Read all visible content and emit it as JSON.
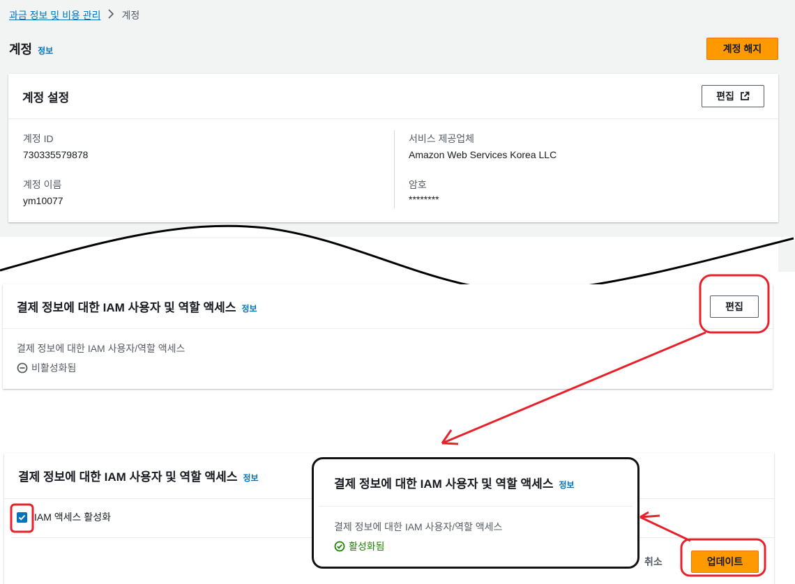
{
  "breadcrumb": {
    "parent": "과금 정보 및 비용 관리",
    "current": "계정"
  },
  "page": {
    "title": "계정",
    "info": "정보",
    "close_account": "계정 해지"
  },
  "account_settings": {
    "title": "계정 설정",
    "edit": "편집",
    "account_id_label": "계정 ID",
    "account_id": "730335579878",
    "account_name_label": "계정 이름",
    "account_name": "ym10077",
    "provider_label": "서비스 제공업체",
    "provider": "Amazon Web Services Korea LLC",
    "password_label": "암호",
    "password": "********"
  },
  "iam_access_view": {
    "title": "결제 정보에 대한 IAM 사용자 및 역할 액세스",
    "info": "정보",
    "edit": "편집",
    "field_label": "결제 정보에 대한 IAM 사용자/역할 액세스",
    "status": "비활성화됨"
  },
  "iam_access_edit": {
    "title": "결제 정보에 대한 IAM 사용자 및 역할 액세스",
    "info": "정보",
    "checkbox_label": "IAM 액세스 활성화",
    "checkbox_checked": true,
    "cancel": "취소",
    "update": "업데이트"
  },
  "iam_access_result": {
    "title": "결제 정보에 대한 IAM 사용자 및 역할 액세스",
    "info": "정보",
    "field_label": "결제 정보에 대한 IAM 사용자/역할 액세스",
    "status": "활성화됨"
  },
  "colors": {
    "primary": "#ff9900",
    "link": "#0073bb",
    "success": "#1d8102",
    "annotation": "#e8202a"
  },
  "icons": [
    "chevron-right-icon",
    "external-link-icon",
    "minus-circle-icon",
    "check-icon",
    "check-circle-icon"
  ]
}
